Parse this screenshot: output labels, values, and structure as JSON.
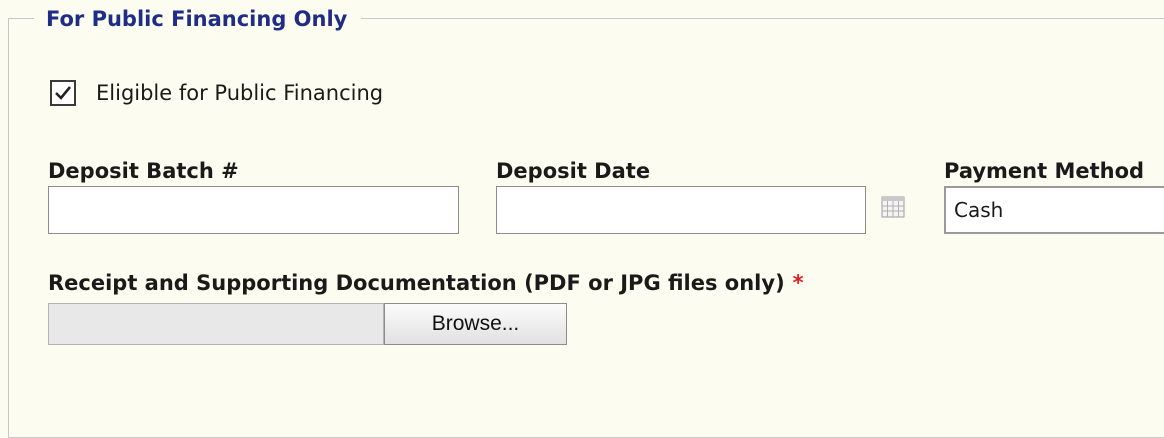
{
  "section": {
    "legend": "For Public Financing Only"
  },
  "eligible": {
    "label": "Eligible for Public Financing",
    "checked": true
  },
  "deposit_batch": {
    "label": "Deposit Batch #",
    "value": ""
  },
  "deposit_date": {
    "label": "Deposit Date",
    "value": ""
  },
  "payment_method": {
    "label": "Payment Method",
    "selected": "Cash"
  },
  "receipt": {
    "label": "Receipt and Supporting Documentation (PDF or JPG files only)",
    "required_marker": "*",
    "browse_label": "Browse..."
  },
  "colors": {
    "legend": "#1f2d86",
    "required": "#e02020",
    "background": "#fdfcf0"
  },
  "icons": {
    "check": "check-icon",
    "calendar": "calendar-icon"
  }
}
